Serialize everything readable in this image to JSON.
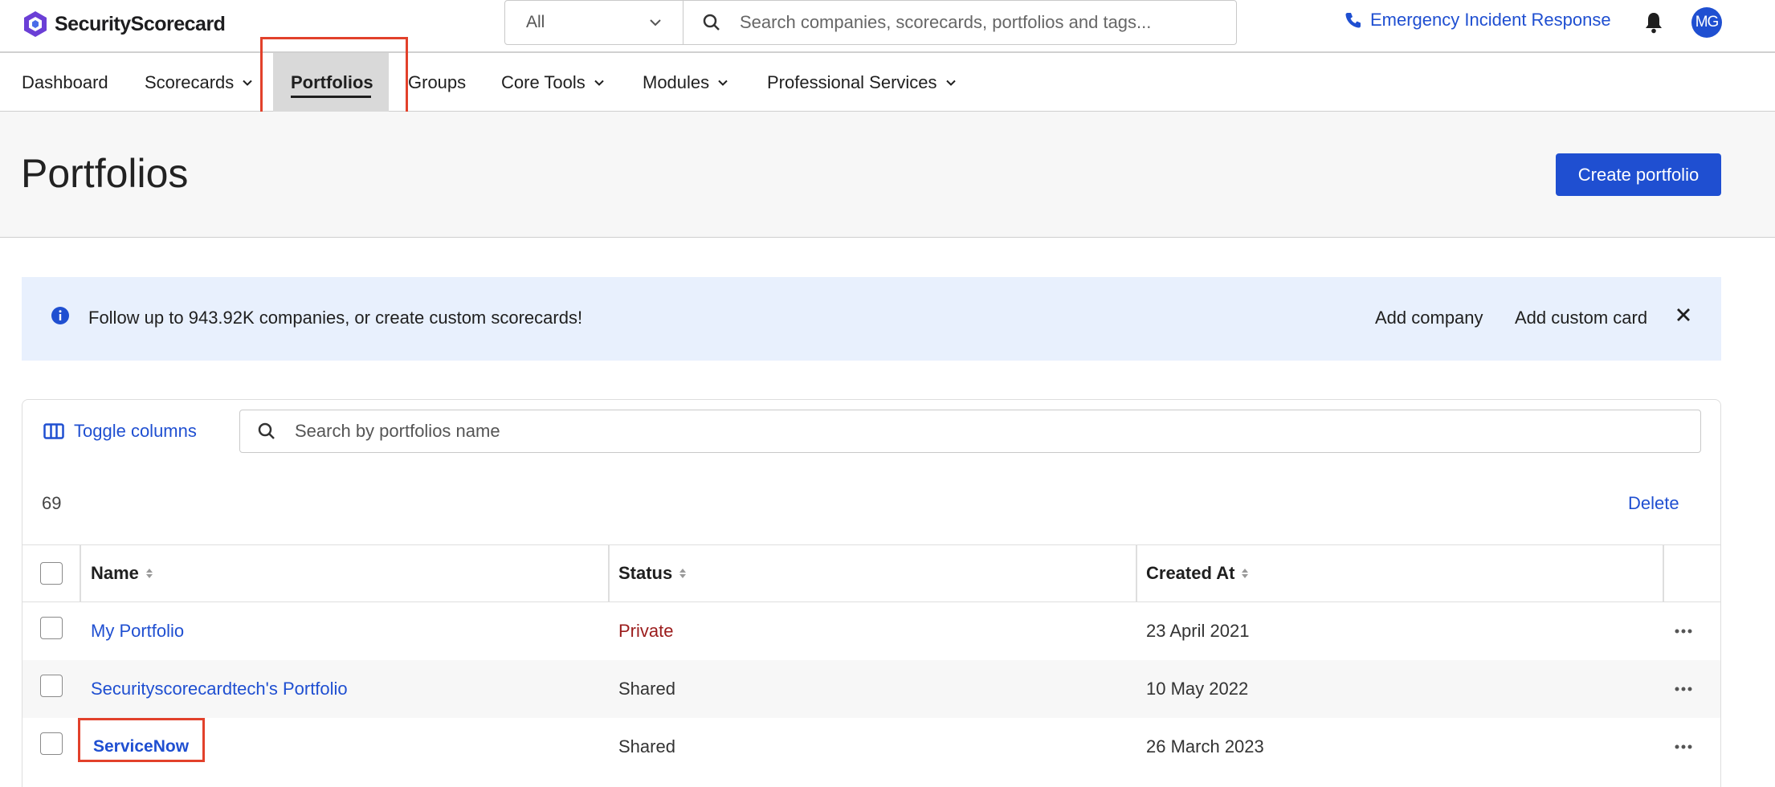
{
  "header": {
    "logo_text": "SecurityScorecard",
    "search_scope": "All",
    "search_placeholder": "Search companies, scorecards, portfolios and tags...",
    "emergency_label": "Emergency Incident Response",
    "avatar_initials": "MG"
  },
  "nav": {
    "items": [
      {
        "label": "Dashboard"
      },
      {
        "label": "Scorecards"
      },
      {
        "label": "Portfolios"
      },
      {
        "label": "Groups"
      },
      {
        "label": "Core Tools"
      },
      {
        "label": "Modules"
      },
      {
        "label": "Professional Services"
      }
    ],
    "active": "Portfolios"
  },
  "page": {
    "title": "Portfolios",
    "create_button": "Create portfolio"
  },
  "banner": {
    "text": "Follow up to 943.92K companies, or create custom scorecards!",
    "add_company": "Add company",
    "add_custom_card": "Add custom card"
  },
  "table": {
    "toggle_columns": "Toggle columns",
    "search_placeholder": "Search by portfolios name",
    "count": "69",
    "delete_label": "Delete",
    "columns": [
      "Name",
      "Status",
      "Created At"
    ],
    "rows": [
      {
        "name": "My Portfolio",
        "status": "Private",
        "created": "23 April 2021"
      },
      {
        "name": "Securityscorecardtech's Portfolio",
        "status": "Shared",
        "created": "10 May 2022"
      },
      {
        "name": "ServiceNow",
        "status": "Shared",
        "created": "26 March 2023"
      }
    ]
  },
  "colors": {
    "accent": "#1f4fd1",
    "banner_bg": "#e8f0fd",
    "private": "#9b1c1c",
    "highlight": "#e2412b"
  }
}
